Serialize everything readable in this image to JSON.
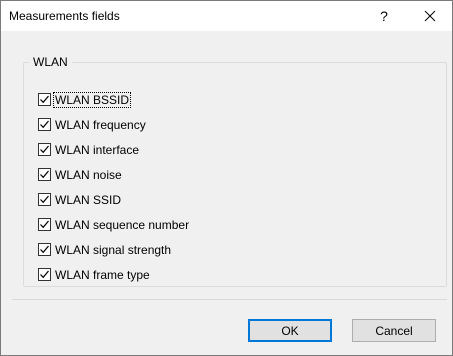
{
  "window": {
    "title": "Measurements fields",
    "help_label": "?",
    "close_icon": "close-icon"
  },
  "group": {
    "label": "WLAN",
    "items": [
      {
        "label": "WLAN BSSID",
        "checked": true,
        "focused": true
      },
      {
        "label": "WLAN frequency",
        "checked": true,
        "focused": false
      },
      {
        "label": "WLAN interface",
        "checked": true,
        "focused": false
      },
      {
        "label": "WLAN noise",
        "checked": true,
        "focused": false
      },
      {
        "label": "WLAN SSID",
        "checked": true,
        "focused": false
      },
      {
        "label": "WLAN sequence number",
        "checked": true,
        "focused": false
      },
      {
        "label": "WLAN signal strength",
        "checked": true,
        "focused": false
      },
      {
        "label": "WLAN frame type",
        "checked": true,
        "focused": false
      }
    ]
  },
  "buttons": {
    "ok_label": "OK",
    "cancel_label": "Cancel"
  },
  "colors": {
    "default_button_border": "#0078d7",
    "dialog_background": "#f0f0f0",
    "titlebar_background": "#ffffff"
  }
}
